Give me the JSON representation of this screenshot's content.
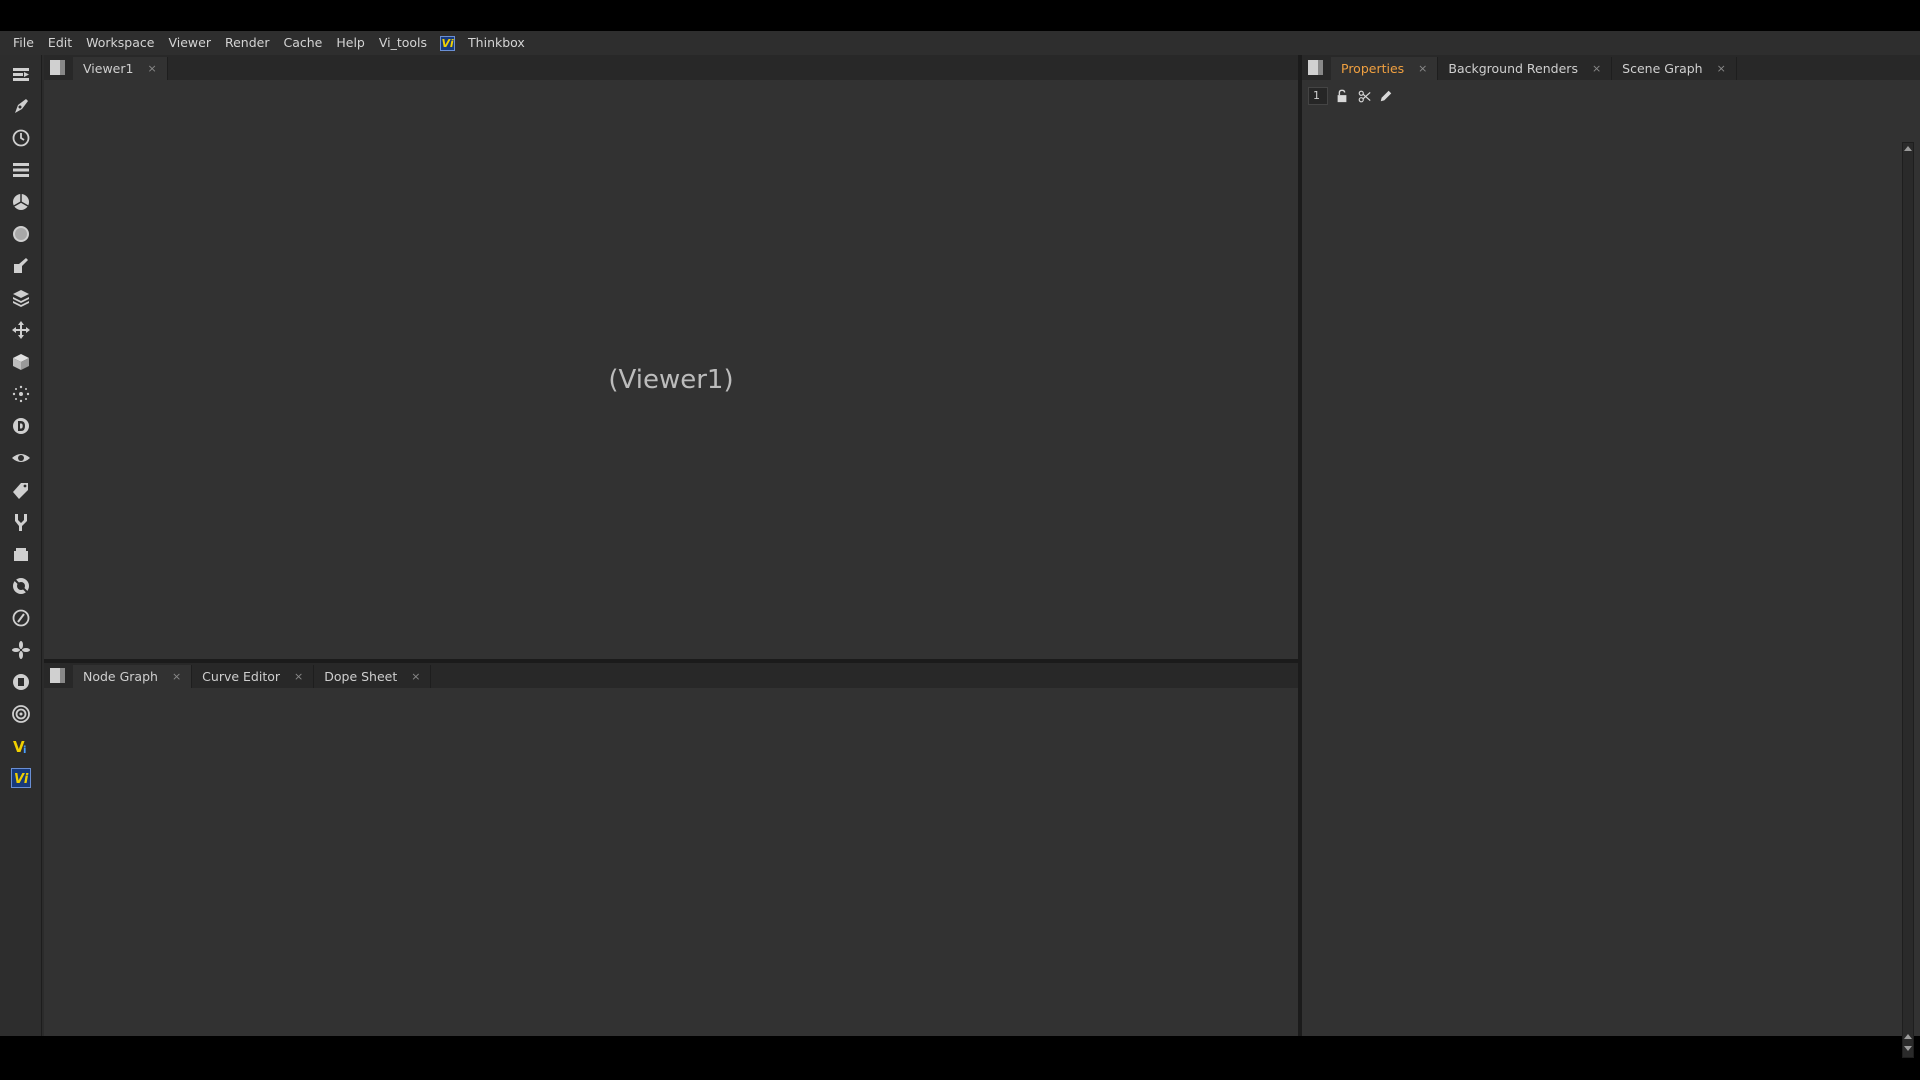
{
  "menubar": {
    "items": [
      "File",
      "Edit",
      "Workspace",
      "Viewer",
      "Render",
      "Cache",
      "Help",
      "Vi_tools"
    ],
    "logo": "Vi",
    "last_item": "Thinkbox"
  },
  "toolbar": {
    "icons": [
      "image-icon",
      "draw-icon",
      "time-icon",
      "channel-icon",
      "color-icon",
      "filter-icon",
      "keyer-icon",
      "merge-icon",
      "transform-icon",
      "3d-icon",
      "particles-icon",
      "deep-icon",
      "views-icon",
      "metadata-icon",
      "toolsets-icon",
      "other-icon",
      "furnace-icon",
      "ocula-icon",
      "nukex-icon",
      "cara-icon",
      "vi-icon",
      "vi-tools-icon"
    ]
  },
  "viewer_pane": {
    "tabs": [
      {
        "label": "Viewer1",
        "close": "×"
      }
    ],
    "placeholder": "(Viewer1)"
  },
  "node_pane": {
    "tabs": [
      {
        "label": "Node Graph",
        "close": "×"
      },
      {
        "label": "Curve Editor",
        "close": "×"
      },
      {
        "label": "Dope Sheet",
        "close": "×"
      }
    ]
  },
  "props_pane": {
    "tabs": [
      {
        "label": "Properties",
        "close": "×"
      },
      {
        "label": "Background Renders",
        "close": "×"
      },
      {
        "label": "Scene Graph",
        "close": "×"
      }
    ],
    "max_panels": "1"
  },
  "colors": {
    "accent": "#f0a040",
    "panel_bg": "#323232",
    "chrome_bg": "#282828"
  }
}
